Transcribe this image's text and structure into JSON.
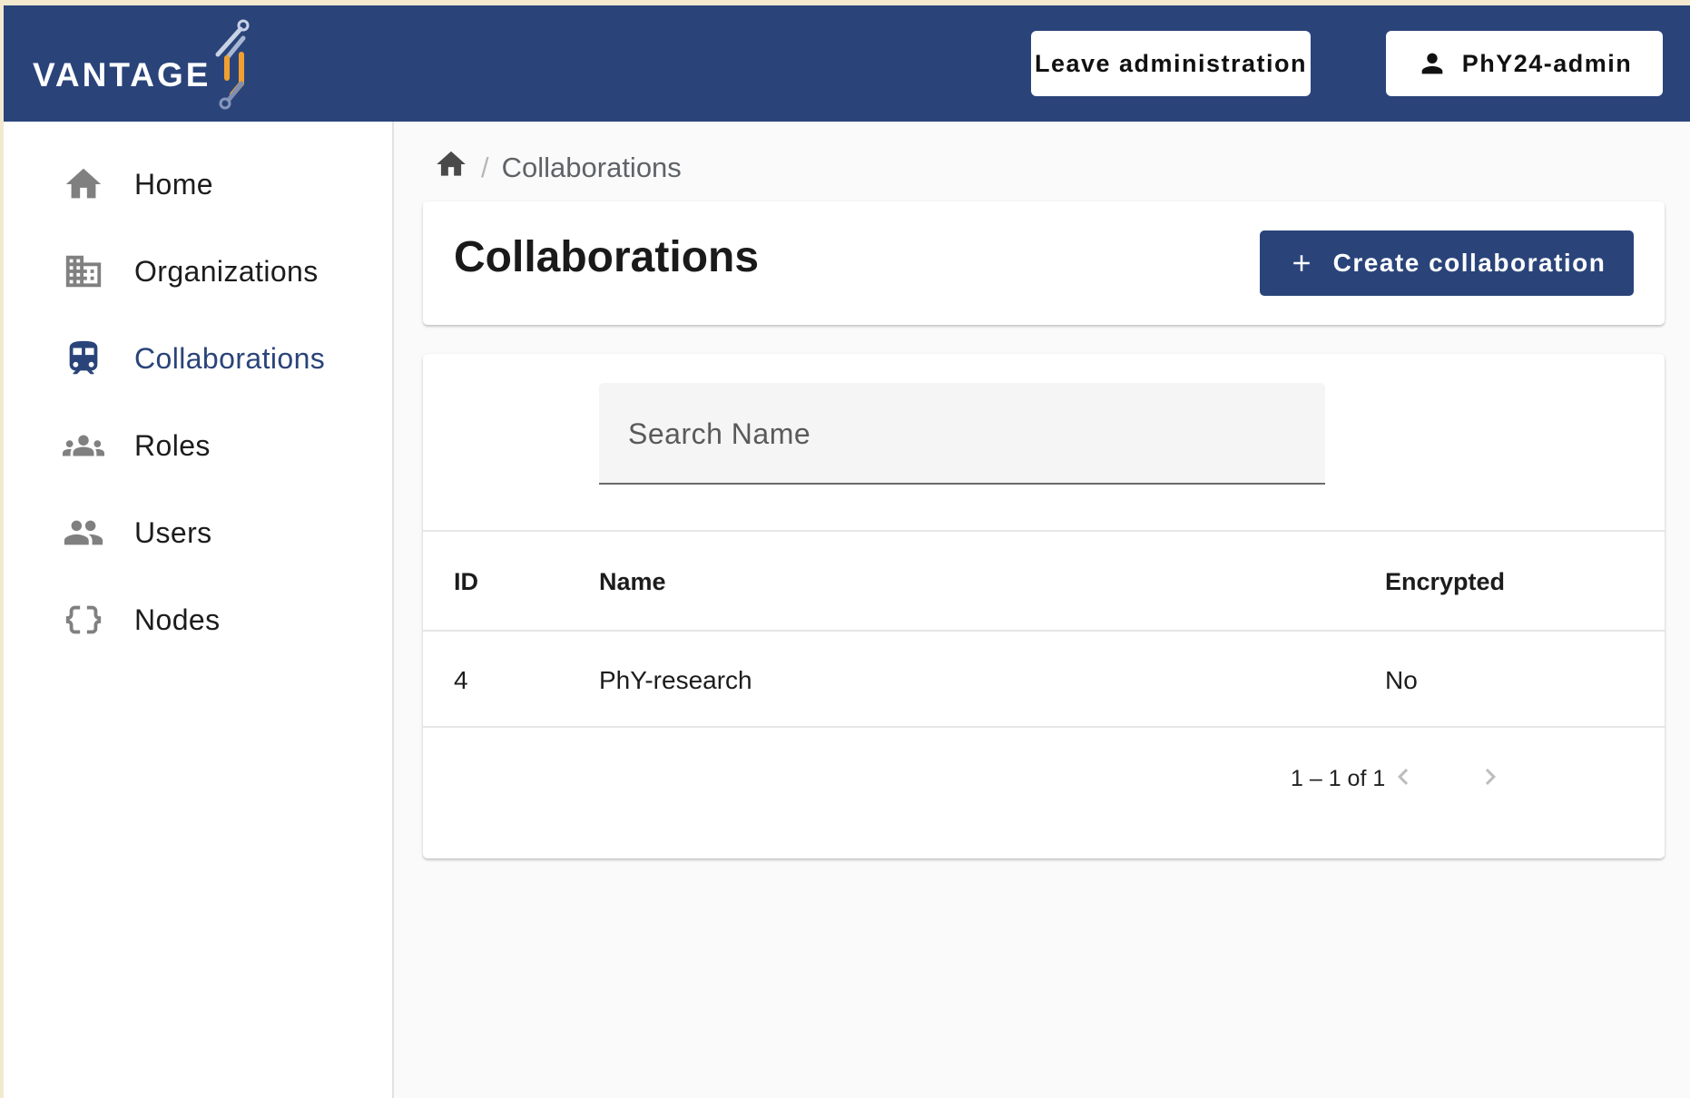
{
  "header": {
    "logo_text": "VANTAGE",
    "leave_admin_label": "Leave administration",
    "user_label": "PhY24-admin"
  },
  "sidebar": {
    "items": [
      {
        "label": "Home",
        "icon": "home-icon"
      },
      {
        "label": "Organizations",
        "icon": "building-icon"
      },
      {
        "label": "Collaborations",
        "icon": "train-icon",
        "active": true
      },
      {
        "label": "Roles",
        "icon": "groups-icon"
      },
      {
        "label": "Users",
        "icon": "people-icon"
      },
      {
        "label": "Nodes",
        "icon": "braces-icon"
      }
    ]
  },
  "breadcrumb": {
    "home_icon": "home-icon",
    "separator": "/",
    "current": "Collaborations"
  },
  "page": {
    "title": "Collaborations",
    "create_label": "Create collaboration"
  },
  "search": {
    "placeholder": "Search Name",
    "value": ""
  },
  "table": {
    "columns": [
      "ID",
      "Name",
      "Encrypted"
    ],
    "rows": [
      [
        "4",
        "PhY-research",
        "No"
      ]
    ]
  },
  "pagination": {
    "range_text": "1 – 1 of 1"
  },
  "colors": {
    "primary": "#2a447a",
    "accent_logo": "#f0a030"
  }
}
